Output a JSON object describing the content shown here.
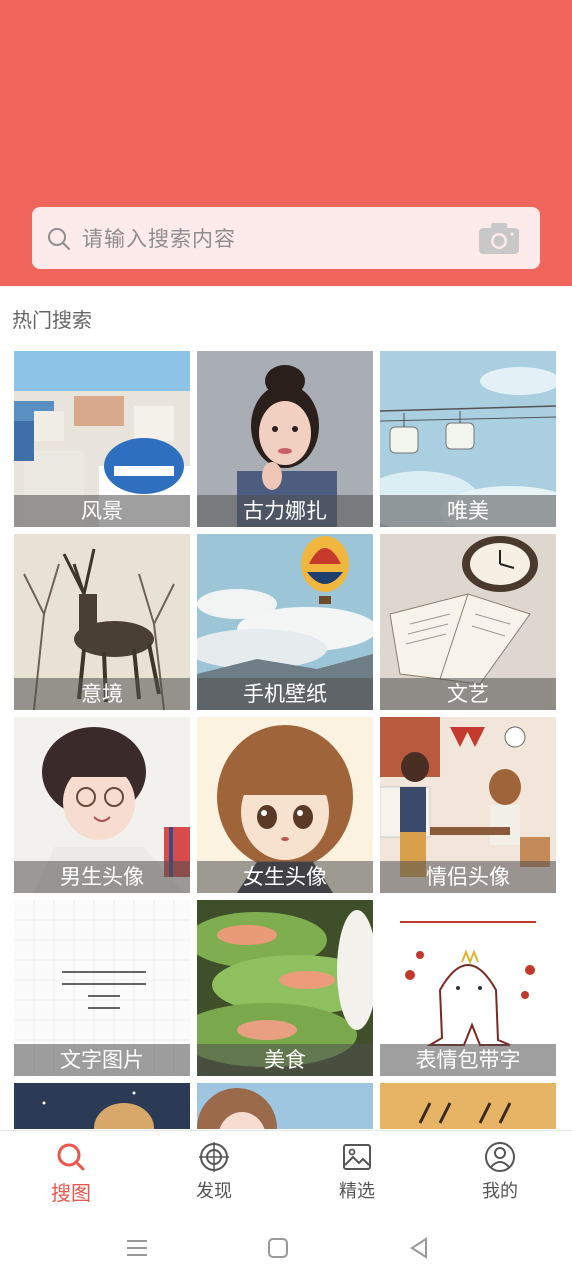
{
  "colors": {
    "header": "#f1665c",
    "search_bg": "#fdeaea",
    "accent": "#e8564d"
  },
  "search": {
    "placeholder": "请输入搜索内容",
    "left_icon": "search-icon",
    "right_icon": "camera-icon"
  },
  "hot_search": {
    "title": "热门搜索",
    "items": [
      {
        "label": "风景"
      },
      {
        "label": "古力娜扎"
      },
      {
        "label": "唯美"
      },
      {
        "label": "意境"
      },
      {
        "label": "手机壁纸"
      },
      {
        "label": "文艺"
      },
      {
        "label": "男生头像"
      },
      {
        "label": "女生头像"
      },
      {
        "label": "情侣头像"
      },
      {
        "label": "文字图片"
      },
      {
        "label": "美食"
      },
      {
        "label": "表情包带字"
      }
    ]
  },
  "bottom_nav": [
    {
      "label": "搜图",
      "icon": "search-icon",
      "active": true
    },
    {
      "label": "发现",
      "icon": "target-icon",
      "active": false
    },
    {
      "label": "精选",
      "icon": "image-icon",
      "active": false
    },
    {
      "label": "我的",
      "icon": "user-icon",
      "active": false
    }
  ],
  "system_nav": [
    "menu-icon",
    "home-icon",
    "back-icon"
  ]
}
